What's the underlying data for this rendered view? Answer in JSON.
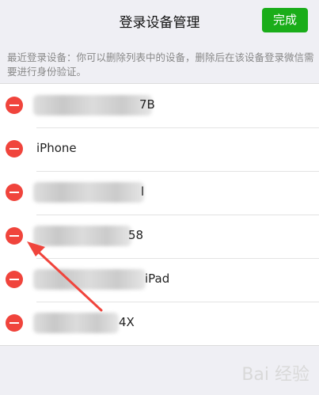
{
  "nav": {
    "title": "登录设备管理",
    "done_label": "完成"
  },
  "hint": "最近登录设备：你可以删除列表中的设备，删除后在该设备登录微信需要进行身份验证。",
  "devices": [
    {
      "name": "7B"
    },
    {
      "name": "iPhone"
    },
    {
      "name": "l"
    },
    {
      "name": "58"
    },
    {
      "name": "iPad"
    },
    {
      "name": "4X"
    }
  ],
  "watermark": "Bai 经验",
  "colors": {
    "accent": "#1aad19",
    "delete": "#f0443c",
    "arrow": "#f0443c"
  }
}
